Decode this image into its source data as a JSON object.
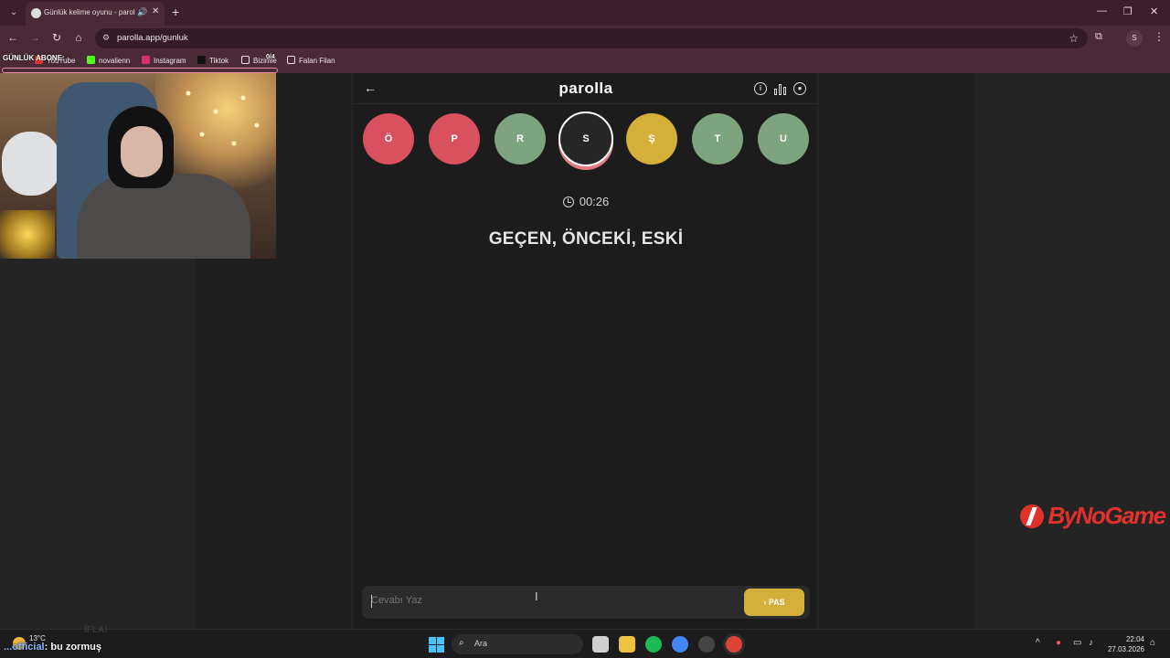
{
  "browser": {
    "tab_title": "Günlük kelime oyunu - parolla",
    "url": "parolla.app/gunluk",
    "profile_initial": "S",
    "bookmarks": [
      "YouTube",
      "novalienn",
      "Instagram",
      "Tiktok",
      "Bizimle",
      "Falan Filan"
    ]
  },
  "app": {
    "brand": "parolla",
    "letters": [
      {
        "char": "Ö",
        "state": "red"
      },
      {
        "char": "P",
        "state": "red"
      },
      {
        "char": "R",
        "state": "green"
      },
      {
        "char": "S",
        "state": "active"
      },
      {
        "char": "Ş",
        "state": "yellow"
      },
      {
        "char": "T",
        "state": "green"
      },
      {
        "char": "U",
        "state": "green"
      }
    ],
    "timer": "00:26",
    "clue": "GEÇEN, ÖNCEKİ, ESKİ",
    "answer_placeholder": "Cevabı Yaz",
    "pass_label": "PAS"
  },
  "stream": {
    "overlay_label": "GÜNLÜK ABONE:",
    "overlay_counter": "0/4",
    "sponsor": "ByNoGame",
    "chat_user": "...official",
    "chat_message": ": bu zormuş",
    "chat_faded": "İFLA!"
  },
  "taskbar": {
    "weather_temp": "13°C",
    "search_label": "Ara",
    "time": "22:04",
    "date": "27.03.2026"
  },
  "colors": {
    "red": "#d9505f",
    "green": "#7ea47f",
    "yellow": "#d4b03a",
    "chrome": "#4a2a37"
  }
}
